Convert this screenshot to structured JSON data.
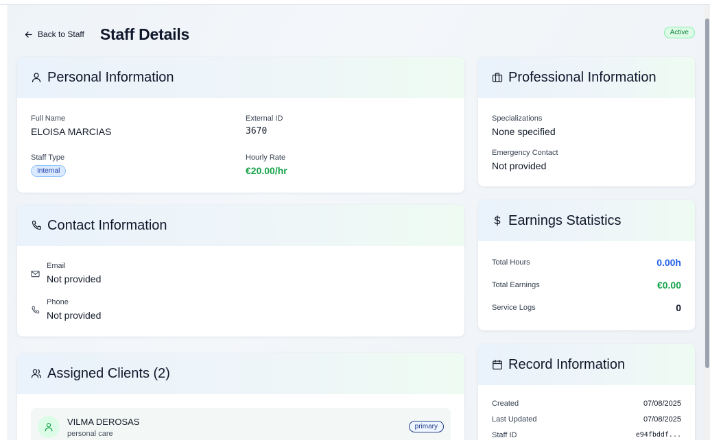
{
  "header": {
    "back_label": "Back to Staff",
    "title": "Staff Details",
    "status": "Active"
  },
  "personal": {
    "title": "Personal Information",
    "full_name_label": "Full Name",
    "full_name": "ELOISA MARCIAS",
    "external_id_label": "External ID",
    "external_id": "3670",
    "staff_type_label": "Staff Type",
    "staff_type": "Internal",
    "hourly_rate_label": "Hourly Rate",
    "hourly_rate": "€20.00/hr"
  },
  "contact": {
    "title": "Contact Information",
    "email_label": "Email",
    "email": "Not provided",
    "phone_label": "Phone",
    "phone": "Not provided"
  },
  "clients": {
    "title": "Assigned Clients (2)",
    "items": [
      {
        "name": "VILMA DEROSAS",
        "service": "personal care",
        "badge": "primary"
      }
    ]
  },
  "professional": {
    "title": "Professional Information",
    "specializations_label": "Specializations",
    "specializations": "None specified",
    "emergency_label": "Emergency Contact",
    "emergency": "Not provided"
  },
  "earnings": {
    "title": "Earnings Statistics",
    "total_hours_label": "Total Hours",
    "total_hours": "0.00h",
    "total_earnings_label": "Total Earnings",
    "total_earnings": "€0.00",
    "service_logs_label": "Service Logs",
    "service_logs": "0"
  },
  "record": {
    "title": "Record Information",
    "created_label": "Created",
    "created": "07/08/2025",
    "updated_label": "Last Updated",
    "updated": "07/08/2025",
    "staff_id_label": "Staff ID",
    "staff_id": "e94fbddf..."
  },
  "colors": {
    "accent_green": "#16a34a",
    "accent_blue": "#2563eb",
    "title": "#0f172a"
  }
}
